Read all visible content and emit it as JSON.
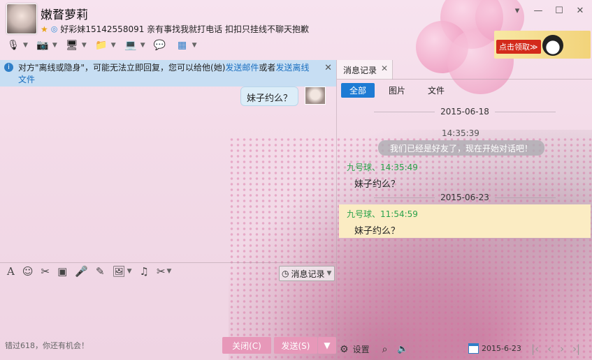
{
  "window": {
    "title": "嫩瞀萝莉",
    "signature": "好彩妹15142558091 亲有事找我就打电话 扣扣只挂线不聊天抱歉",
    "controls": [
      "▾",
      "—",
      "☐",
      "✕"
    ]
  },
  "ad": {
    "button": "点击领取≫"
  },
  "toolbar": {
    "items": [
      {
        "name": "voice",
        "icon": "🎙"
      },
      {
        "name": "video",
        "icon": "📷"
      },
      {
        "name": "remote",
        "icon": "🖥"
      },
      {
        "name": "file",
        "icon": "📁"
      },
      {
        "name": "share-screen",
        "icon": "💻"
      },
      {
        "name": "invite",
        "icon": "💬"
      },
      {
        "name": "apps",
        "icon": "▦"
      }
    ]
  },
  "notice": {
    "text_before": "对方\"离线或隐身\"，可能无法立即回复，您可以给他(她)",
    "link_email": "发送邮件",
    "text_mid": "或者",
    "link_offline": "发送离线文件"
  },
  "chat": {
    "my_message": "妹子约么？",
    "bottom_tip": "错过618，你还有机会！",
    "close_label": "关闭(C)",
    "send_label": "发送(S)",
    "history_label": "消息记录"
  },
  "edit_tools": [
    "A",
    "☺",
    "✂",
    "▣",
    "🎤",
    "✎",
    "🖼",
    "♫",
    "✂"
  ],
  "history": {
    "tab_label": "消息记录",
    "filters": [
      "全部",
      "图片",
      "文件"
    ],
    "date1": "2015-06-18",
    "time1": "14:35:39",
    "system_msg": "我们已经是好友了，现在开始对话吧！",
    "sender1": "九号球、14:35:49",
    "msg1": "妹子约么？",
    "date2": "2015-06-23",
    "sender2": "九号球、11:54:59",
    "msg2": "妹子约么？",
    "settings_label": "设置",
    "date_field": "2015-6-23",
    "nav": [
      "|‹",
      "‹",
      "›",
      "›|"
    ]
  }
}
